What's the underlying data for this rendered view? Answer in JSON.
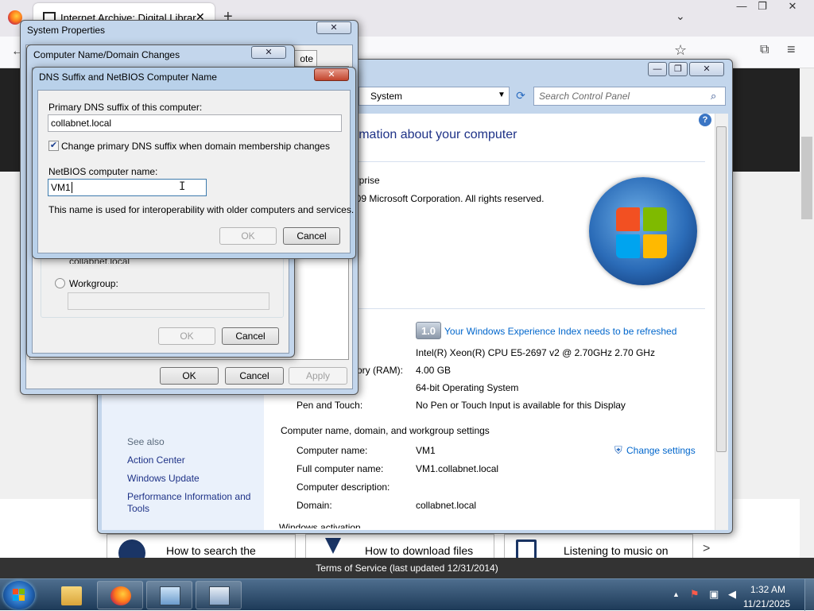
{
  "browser": {
    "tab_title": "Internet Archive: Digital Librar",
    "tab_close": "✕",
    "new_tab": "+",
    "tabs_dropdown": "⌄",
    "back": "←",
    "bookmark": "☆",
    "extensions": "⧉",
    "menu": "≡",
    "win_min": "—",
    "win_max": "❐",
    "win_close": "✕",
    "cards": [
      {
        "label": "How to search the"
      },
      {
        "label": "How to download files"
      },
      {
        "label": "Listening to music on"
      }
    ],
    "next_arrow": ">",
    "tos": "Terms of Service (last updated 12/31/2014)"
  },
  "control_panel": {
    "address": "System",
    "search_placeholder": "Search Control Panel",
    "help": "?",
    "heading": "ormation about your computer",
    "edition_fragment": "erprise",
    "copyright_fragment": "009 Microsoft Corporation.  All rights reserved.",
    "wei_score": "1.0",
    "wei_link": "Your Windows Experience Index needs to be refreshed",
    "processor_value": "Intel(R) Xeon(R) CPU E5-2697 v2 @ 2.70GHz   2.70 GHz",
    "ram_label_fragment": "ory (RAM):",
    "ram_value": "4.00 GB",
    "system_type_value": "64-bit Operating System",
    "pen_label": "Pen and Touch:",
    "pen_value": "No Pen or Touch Input is available for this Display",
    "section_computer_name": "Computer name, domain, and workgroup settings",
    "computer_name_label": "Computer name:",
    "computer_name_value": "VM1",
    "full_name_label": "Full computer name:",
    "full_name_value": "VM1.collabnet.local",
    "description_label": "Computer description:",
    "domain_label": "Domain:",
    "domain_value": "collabnet.local",
    "change_settings": "Change settings",
    "section_activation_fragment": "Windows activation",
    "see_also": "See also",
    "left_links": [
      "Action Center",
      "Windows Update",
      "Performance Information and Tools"
    ]
  },
  "system_properties": {
    "title": "System Properties",
    "close": "✕",
    "tab_remote_fragment": "ote",
    "ok": "OK",
    "cancel": "Cancel",
    "apply": "Apply"
  },
  "name_changes": {
    "title": "Computer Name/Domain Changes",
    "close": "✕",
    "domain_value_fragment": "collabnet.local",
    "workgroup_label": "Workgroup:",
    "ok": "OK",
    "cancel": "Cancel"
  },
  "dns_dialog": {
    "title": "DNS Suffix and NetBIOS Computer Name",
    "close": "✕",
    "primary_dns_label": "Primary DNS suffix of this computer:",
    "primary_dns_value": "collabnet.local",
    "change_checkbox_label": "Change primary DNS suffix when domain membership changes",
    "change_checkbox_checked": true,
    "netbios_label": "NetBIOS computer name:",
    "netbios_value": "VM1",
    "info_text": "This name is used for interoperability with older computers and services.",
    "ok": "OK",
    "cancel": "Cancel"
  },
  "taskbar": {
    "pinned": [
      "explorer",
      "firefox",
      "control-panel",
      "system-properties"
    ],
    "tray_up": "▲",
    "time": "1:32 AM",
    "date": "11/21/2025"
  },
  "colors": {
    "dialog_bg": "#f0f0f0",
    "win7_frame": "#c3d6ec",
    "link": "#0066cc",
    "heading": "#1e3287",
    "taskbar": "#1d3a58"
  }
}
